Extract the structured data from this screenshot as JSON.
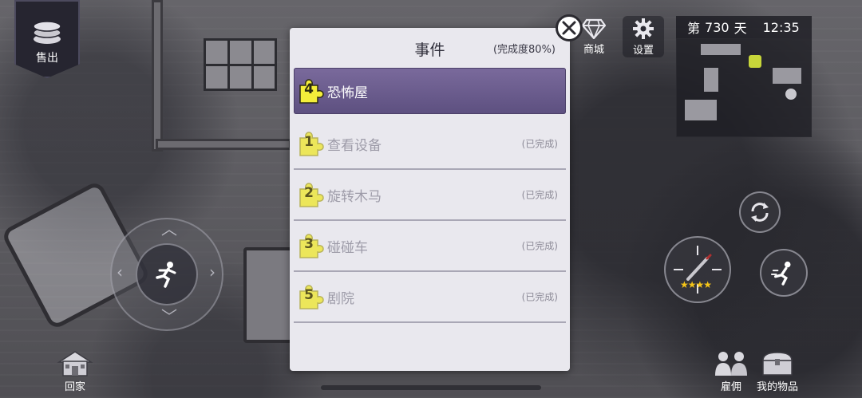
{
  "hud": {
    "sell_label": "售出",
    "shop_label": "商城",
    "settings_label": "设置",
    "day_prefix": "第",
    "day_number": "730",
    "day_suffix": "天",
    "clock": "12:35",
    "home_label": "回家",
    "hire_label": "雇佣",
    "items_label": "我的物品",
    "attack_stars": 4
  },
  "modal": {
    "title": "事件",
    "progress": "(完成度80%)",
    "events": [
      {
        "number": "4",
        "name": "恐怖屋",
        "status": "",
        "active": true
      },
      {
        "number": "1",
        "name": "查看设备",
        "status": "(已完成)",
        "active": false
      },
      {
        "number": "2",
        "name": "旋转木马",
        "status": "(已完成)",
        "active": false
      },
      {
        "number": "3",
        "name": "碰碰车",
        "status": "(已完成)",
        "active": false
      },
      {
        "number": "5",
        "name": "剧院",
        "status": "(已完成)",
        "active": false
      }
    ]
  },
  "colors": {
    "active_row": "#6b5d8e",
    "puzzle_yellow": "#ece65a",
    "modal_bg": "#e9e8ee"
  }
}
